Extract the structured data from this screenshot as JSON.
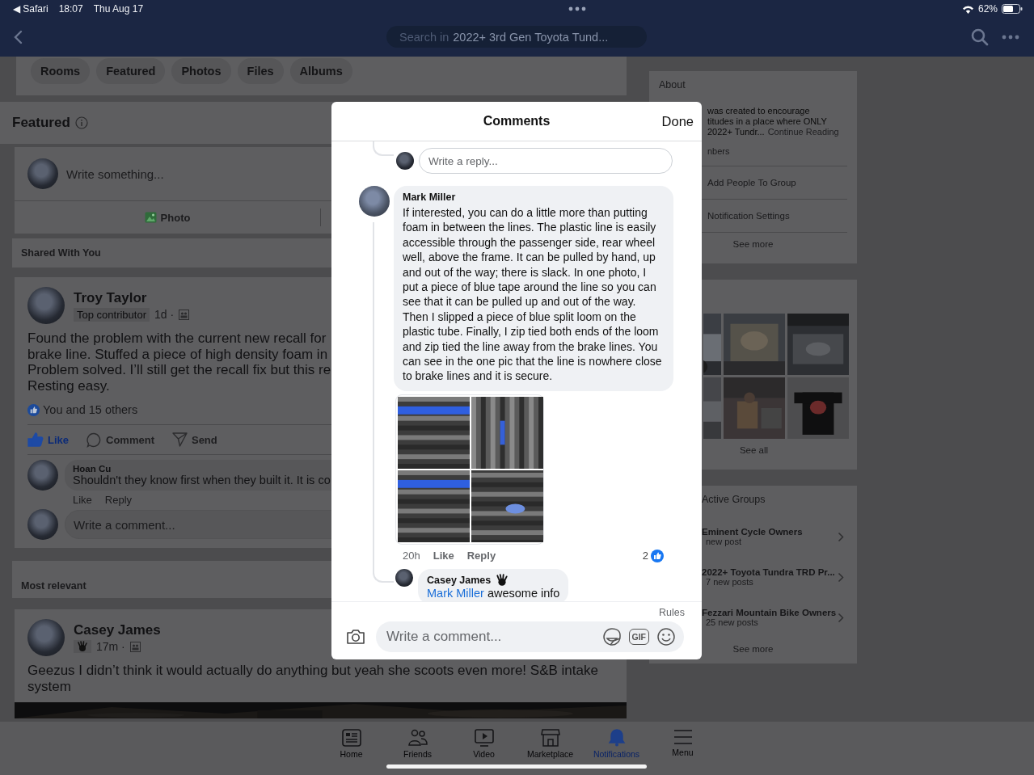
{
  "status_bar": {
    "back_arrow": "◀",
    "back_app": "Safari",
    "time": "18:07",
    "date": "Thu Aug 17",
    "battery": "62%"
  },
  "nav": {
    "search_prefix": "Search in",
    "search_scope": "2022+ 3rd Gen Toyota Tund..."
  },
  "group_tabs": [
    {
      "label": "Rooms",
      "selected": false
    },
    {
      "label": "Featured",
      "selected": false
    },
    {
      "label": "Photos",
      "selected": false
    },
    {
      "label": "Files",
      "selected": false
    },
    {
      "label": "Albums",
      "selected": false
    }
  ],
  "featured": {
    "title": "Featured"
  },
  "composer": {
    "placeholder": "Write something...",
    "photo_label": "Photo"
  },
  "shared_label": "Shared With You",
  "most_relevant_label": "Most relevant",
  "posts": [
    {
      "author": "Troy Taylor",
      "badge": {
        "kind": "text",
        "label": "Top contributor"
      },
      "time": "1d ·",
      "body_lines": [
        "Found the problem with the current new recall for",
        "brake line. Stuffed a piece of high density foam in",
        "Problem solved. I’ll still get the recall fix but this re",
        "Resting easy."
      ],
      "reactions": "You and 15 others",
      "actions": [
        {
          "kind": "like",
          "label": "Like",
          "selected": true
        },
        {
          "kind": "comment",
          "label": "Comment",
          "selected": false
        },
        {
          "kind": "send",
          "label": "Send",
          "selected": false
        }
      ],
      "comments": [
        {
          "author": "Hoan Cu",
          "text": "Shouldn't they know first when they built it. It is co",
          "actions": [
            "Like",
            "Reply"
          ]
        }
      ],
      "comment_placeholder": "Write a comment..."
    },
    {
      "author": "Casey James",
      "badge": {
        "kind": "wave"
      },
      "time": "17m ·",
      "body_lines": [
        "Geezus I didn’t think it would actually do anything but yeah she scoots even more! S&B intake",
        "system"
      ],
      "media": {
        "kind": "picture"
      }
    }
  ],
  "about": {
    "title": "About",
    "description_lines": [
      "was created to encourage",
      "titudes in a place where ONLY",
      "2022+ Tundr..."
    ],
    "continue": "Continue Reading",
    "members": "nbers",
    "actions": [
      "Add People To Group",
      "Notification Settings"
    ],
    "see_more": "See more"
  },
  "group_photos": {
    "photos": [
      {
        "kind": "picture"
      },
      {
        "kind": "picture"
      },
      {
        "kind": "picture"
      },
      {
        "kind": "picture"
      },
      {
        "kind": "picture"
      },
      {
        "kind": "picture"
      }
    ],
    "see_all": "See all"
  },
  "active_groups": {
    "title": "Active Groups",
    "items": [
      {
        "name": "Eminent Cycle Owners",
        "meta": "new post"
      },
      {
        "name": "2022+ Toyota Tundra TRD Pr...",
        "meta": "7 new posts"
      },
      {
        "name": "Fezzari Mountain Bike Owners",
        "meta": "25 new posts"
      }
    ],
    "see_more": "See more"
  },
  "comments_dialog": {
    "title": "Comments",
    "done": "Done",
    "reply_placeholder": "Write a reply...",
    "comment": {
      "author": "Mark Miller",
      "text": "If interested, you can do a little more than putting foam in between the lines. The plastic line is easily accessible through the passenger side, rear wheel well, above the frame. It can be pulled by hand, up and out of the way; there is slack. In one photo, I put a piece of blue tape around the line so you can see that it can be pulled up and out of the way. Then I slipped a piece of blue split loom on the plastic tube. Finally, I zip tied both ends of the loom and zip tied the line away from the brake lines. You can see in the one pic that the line is nowhere close to brake lines and it is secure.",
      "photos": [
        {
          "kind": "picture"
        },
        {
          "kind": "picture"
        },
        {
          "kind": "picture"
        },
        {
          "kind": "picture"
        }
      ],
      "time": "20h",
      "actions": [
        "Like",
        "Reply"
      ],
      "like_count": "2"
    },
    "reply": {
      "author": "Casey James",
      "mention": "Mark Miller",
      "text": "awesome info"
    },
    "rules": "Rules",
    "comment_placeholder": "Write a comment...",
    "gif_label": "GIF"
  },
  "bottom_nav": [
    {
      "kind": "home",
      "label": "Home",
      "selected": false
    },
    {
      "kind": "friends",
      "label": "Friends",
      "selected": false
    },
    {
      "kind": "video",
      "label": "Video",
      "selected": false
    },
    {
      "kind": "marketplace",
      "label": "Marketplace",
      "selected": false
    },
    {
      "kind": "notifications",
      "label": "Notifications",
      "selected": true
    },
    {
      "kind": "menu",
      "label": "Menu",
      "selected": false
    }
  ]
}
